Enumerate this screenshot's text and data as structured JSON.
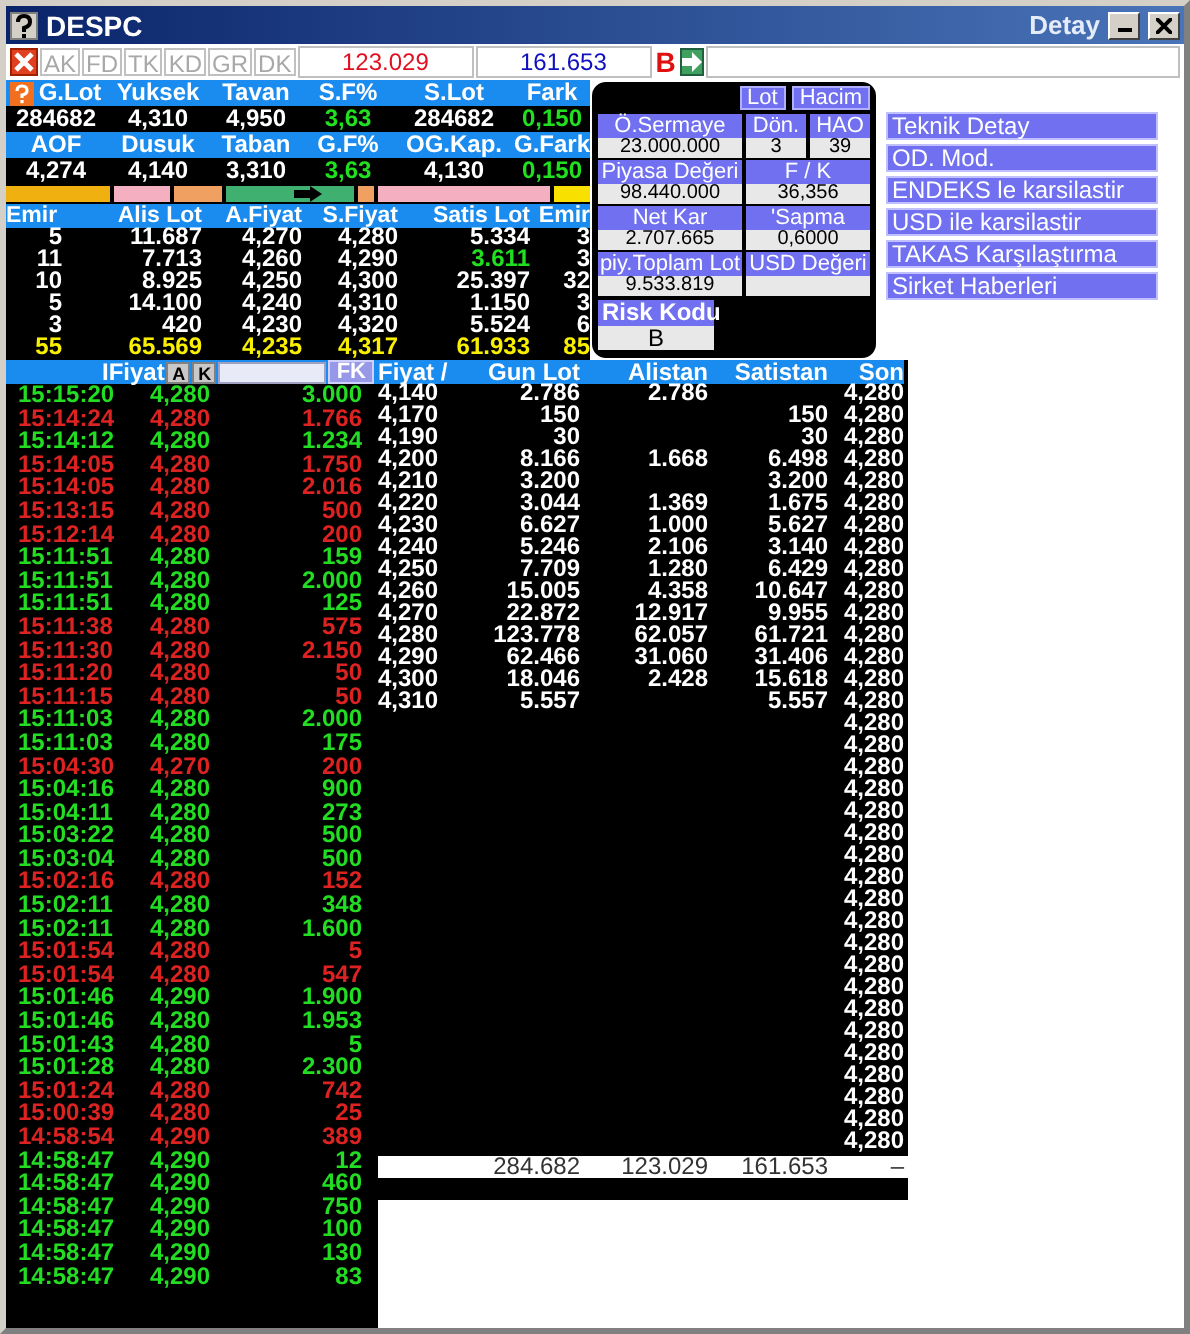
{
  "window": {
    "title": "DESPC",
    "right_title": "Detay"
  },
  "toolbar": {
    "tabs": [
      {
        "label": "AK",
        "disabled": true
      },
      {
        "label": "FD",
        "disabled": true
      },
      {
        "label": "TK",
        "disabled": true
      },
      {
        "label": "KD",
        "disabled": true
      },
      {
        "label": "GR",
        "disabled": true
      },
      {
        "label": "DK",
        "disabled": true
      }
    ],
    "buy_total": "123.029",
    "sell_total": "161.653",
    "mark": "B"
  },
  "stats_rows": [
    {
      "cells": [
        {
          "label": "G.Lot",
          "value": "284682",
          "positive": false
        },
        {
          "label": "Yuksek",
          "value": "4,310",
          "positive": false
        },
        {
          "label": "Tavan",
          "value": "4,950",
          "positive": false
        },
        {
          "label": "S.F%",
          "value": "3,63",
          "positive": true
        },
        {
          "label": "S.Lot",
          "value": "284682",
          "positive": false
        },
        {
          "label": "Fark",
          "value": "0,150",
          "positive": true
        }
      ]
    },
    {
      "cells": [
        {
          "label": "AOF",
          "value": "4,274",
          "positive": false
        },
        {
          "label": "Dusuk",
          "value": "4,140",
          "positive": false
        },
        {
          "label": "Taban",
          "value": "3,310",
          "positive": false
        },
        {
          "label": "G.F%",
          "value": "3,63",
          "positive": true
        },
        {
          "label": "OG.Kap.",
          "value": "4,130",
          "positive": false
        },
        {
          "label": "G.Fark",
          "value": "0,150",
          "positive": true
        }
      ]
    }
  ],
  "order_book": {
    "columns": [
      "Emir",
      "Alis Lot",
      "A.Fiyat",
      "S.Fiyat",
      "Satis Lot",
      "Emir"
    ],
    "rows": [
      {
        "cells": [
          "5",
          "11.687",
          "4,270",
          "4,280",
          "5.334",
          "3"
        ],
        "satis_lot_up": false
      },
      {
        "cells": [
          "11",
          "7.713",
          "4,260",
          "4,290",
          "3.611",
          "3"
        ],
        "satis_lot_up": true
      },
      {
        "cells": [
          "10",
          "8.925",
          "4,250",
          "4,300",
          "25.397",
          "32"
        ],
        "satis_lot_up": false
      },
      {
        "cells": [
          "5",
          "14.100",
          "4,240",
          "4,310",
          "1.150",
          "3"
        ],
        "satis_lot_up": false
      },
      {
        "cells": [
          "3",
          "420",
          "4,230",
          "4,320",
          "5.524",
          "6"
        ],
        "satis_lot_up": false
      }
    ],
    "total": [
      "55",
      "65.569",
      "4,235",
      "4,317",
      "61.933",
      "85"
    ]
  },
  "info_panel": {
    "toggles": [
      "Lot",
      "Hacim"
    ],
    "rows": [
      [
        {
          "label": "Ö.Sermaye",
          "value": "23.000.000"
        },
        {
          "label": "Dön.",
          "value": "3"
        },
        {
          "label": "HAO",
          "value": "39"
        }
      ],
      [
        {
          "label": "Piyasa Değeri",
          "value": "98.440.000"
        },
        {
          "label": "F / K",
          "value": "36,356"
        }
      ],
      [
        {
          "label": "Net Kar",
          "value": "2.707.665"
        },
        {
          "label": "'Sapma",
          "value": "0,6000"
        }
      ],
      [
        {
          "label": "piy.Toplam Lot",
          "value": "9.533.819"
        },
        {
          "label": "USD Değeri"
        }
      ]
    ],
    "risk": {
      "label": "Risk Kodu",
      "value": "B"
    }
  },
  "actions": [
    "Teknik Detay",
    "OD. Mod.",
    "ENDEKS le karsilastir",
    "USD ile karsilastir",
    "TAKAS Karşılaştırma",
    "Sirket Haberleri"
  ],
  "trades": {
    "header": "IFiyat",
    "buttons": [
      "A",
      "K"
    ],
    "filter_button": "FK",
    "rows": [
      {
        "time": "15:15:20",
        "price": "4,280",
        "lot": "3.000",
        "color": "#22dd22"
      },
      {
        "time": "15:14:24",
        "price": "4,280",
        "lot": "1.766",
        "color": "#dd2222"
      },
      {
        "time": "15:14:12",
        "price": "4,280",
        "lot": "1.234",
        "color": "#22dd22"
      },
      {
        "time": "15:14:05",
        "price": "4,280",
        "lot": "1.750",
        "color": "#dd2222"
      },
      {
        "time": "15:14:05",
        "price": "4,280",
        "lot": "2.016",
        "color": "#dd2222"
      },
      {
        "time": "15:13:15",
        "price": "4,280",
        "lot": "500",
        "color": "#dd2222"
      },
      {
        "time": "15:12:14",
        "price": "4,280",
        "lot": "200",
        "color": "#dd2222"
      },
      {
        "time": "15:11:51",
        "price": "4,280",
        "lot": "159",
        "color": "#22dd22"
      },
      {
        "time": "15:11:51",
        "price": "4,280",
        "lot": "2.000",
        "color": "#22dd22"
      },
      {
        "time": "15:11:51",
        "price": "4,280",
        "lot": "125",
        "color": "#22dd22"
      },
      {
        "time": "15:11:38",
        "price": "4,280",
        "lot": "575",
        "color": "#dd2222"
      },
      {
        "time": "15:11:30",
        "price": "4,280",
        "lot": "2.150",
        "color": "#dd2222"
      },
      {
        "time": "15:11:20",
        "price": "4,280",
        "lot": "50",
        "color": "#dd2222"
      },
      {
        "time": "15:11:15",
        "price": "4,280",
        "lot": "50",
        "color": "#dd2222"
      },
      {
        "time": "15:11:03",
        "price": "4,280",
        "lot": "2.000",
        "color": "#22dd22"
      },
      {
        "time": "15:11:03",
        "price": "4,280",
        "lot": "175",
        "color": "#22dd22"
      },
      {
        "time": "15:04:30",
        "price": "4,270",
        "lot": "200",
        "color": "#dd2222"
      },
      {
        "time": "15:04:16",
        "price": "4,280",
        "lot": "900",
        "color": "#22dd22"
      },
      {
        "time": "15:04:11",
        "price": "4,280",
        "lot": "273",
        "color": "#22dd22"
      },
      {
        "time": "15:03:22",
        "price": "4,280",
        "lot": "500",
        "color": "#22dd22"
      },
      {
        "time": "15:03:04",
        "price": "4,280",
        "lot": "500",
        "color": "#22dd22"
      },
      {
        "time": "15:02:16",
        "price": "4,280",
        "lot": "152",
        "color": "#dd2222"
      },
      {
        "time": "15:02:11",
        "price": "4,280",
        "lot": "348",
        "color": "#22dd22"
      },
      {
        "time": "15:02:11",
        "price": "4,280",
        "lot": "1.600",
        "color": "#22dd22"
      },
      {
        "time": "15:01:54",
        "price": "4,280",
        "lot": "5",
        "color": "#dd2222"
      },
      {
        "time": "15:01:54",
        "price": "4,280",
        "lot": "547",
        "color": "#dd2222"
      },
      {
        "time": "15:01:46",
        "price": "4,290",
        "lot": "1.900",
        "color": "#22dd22"
      },
      {
        "time": "15:01:46",
        "price": "4,280",
        "lot": "1.953",
        "color": "#22dd22"
      },
      {
        "time": "15:01:43",
        "price": "4,280",
        "lot": "5",
        "color": "#22dd22"
      },
      {
        "time": "15:01:28",
        "price": "4,280",
        "lot": "2.300",
        "color": "#22dd22"
      },
      {
        "time": "15:01:24",
        "price": "4,280",
        "lot": "742",
        "color": "#dd2222"
      },
      {
        "time": "15:00:39",
        "price": "4,280",
        "lot": "25",
        "color": "#dd2222"
      },
      {
        "time": "14:58:54",
        "price": "4,290",
        "lot": "389",
        "color": "#dd2222"
      },
      {
        "time": "14:58:47",
        "price": "4,290",
        "lot": "12",
        "color": "#22dd22"
      },
      {
        "time": "14:58:47",
        "price": "4,290",
        "lot": "460",
        "color": "#22dd22"
      },
      {
        "time": "14:58:47",
        "price": "4,290",
        "lot": "750",
        "color": "#22dd22"
      },
      {
        "time": "14:58:47",
        "price": "4,290",
        "lot": "100",
        "color": "#22dd22"
      },
      {
        "time": "14:58:47",
        "price": "4,290",
        "lot": "130",
        "color": "#22dd22"
      },
      {
        "time": "14:58:47",
        "price": "4,290",
        "lot": "83",
        "color": "#22dd22"
      }
    ]
  },
  "price_table": {
    "columns": [
      "Fiyat /",
      "Gun Lot",
      "Alistan",
      "Satistan",
      "Son"
    ],
    "rows": [
      {
        "fiyat": "4,140",
        "gun_lot": "2.786",
        "alistan": "2.786",
        "son": "4,280"
      },
      {
        "fiyat": "4,170",
        "gun_lot": "150",
        "satistan": "150",
        "son": "4,280"
      },
      {
        "fiyat": "4,190",
        "gun_lot": "30",
        "satistan": "30",
        "son": "4,280"
      },
      {
        "fiyat": "4,200",
        "gun_lot": "8.166",
        "alistan": "1.668",
        "satistan": "6.498",
        "son": "4,280"
      },
      {
        "fiyat": "4,210",
        "gun_lot": "3.200",
        "satistan": "3.200",
        "son": "4,280"
      },
      {
        "fiyat": "4,220",
        "gun_lot": "3.044",
        "alistan": "1.369",
        "satistan": "1.675",
        "son": "4,280"
      },
      {
        "fiyat": "4,230",
        "gun_lot": "6.627",
        "alistan": "1.000",
        "satistan": "5.627",
        "son": "4,280"
      },
      {
        "fiyat": "4,240",
        "gun_lot": "5.246",
        "alistan": "2.106",
        "satistan": "3.140",
        "son": "4,280"
      },
      {
        "fiyat": "4,250",
        "gun_lot": "7.709",
        "alistan": "1.280",
        "satistan": "6.429",
        "son": "4,280"
      },
      {
        "fiyat": "4,260",
        "gun_lot": "15.005",
        "alistan": "4.358",
        "satistan": "10.647",
        "son": "4,280"
      },
      {
        "fiyat": "4,270",
        "gun_lot": "22.872",
        "alistan": "12.917",
        "satistan": "9.955",
        "son": "4,280"
      },
      {
        "fiyat": "4,280",
        "gun_lot": "123.778",
        "alistan": "62.057",
        "satistan": "61.721",
        "son": "4,280"
      },
      {
        "fiyat": "4,290",
        "gun_lot": "62.466",
        "alistan": "31.060",
        "satistan": "31.406",
        "son": "4,280"
      },
      {
        "fiyat": "4,300",
        "gun_lot": "18.046",
        "alistan": "2.428",
        "satistan": "15.618",
        "son": "4,280"
      },
      {
        "fiyat": "4,310",
        "gun_lot": "5.557",
        "satistan": "5.557",
        "son": "4,280"
      },
      {
        "son": "4,280"
      },
      {
        "son": "4,280"
      },
      {
        "son": "4,280"
      },
      {
        "son": "4,280"
      },
      {
        "son": "4,280"
      },
      {
        "son": "4,280"
      },
      {
        "son": "4,280"
      },
      {
        "son": "4,280"
      },
      {
        "son": "4,280"
      },
      {
        "son": "4,280"
      },
      {
        "son": "4,280"
      },
      {
        "son": "4,280"
      },
      {
        "son": "4,280"
      },
      {
        "son": "4,280"
      },
      {
        "son": "4,280"
      },
      {
        "son": "4,280"
      },
      {
        "son": "4,280"
      },
      {
        "son": "4,280"
      },
      {
        "son": "4,280"
      },
      {
        "son": "4,280"
      }
    ],
    "totals": {
      "gun_lot": "284.682",
      "alistan": "123.029",
      "satistan": "161.653",
      "son": "–"
    }
  }
}
